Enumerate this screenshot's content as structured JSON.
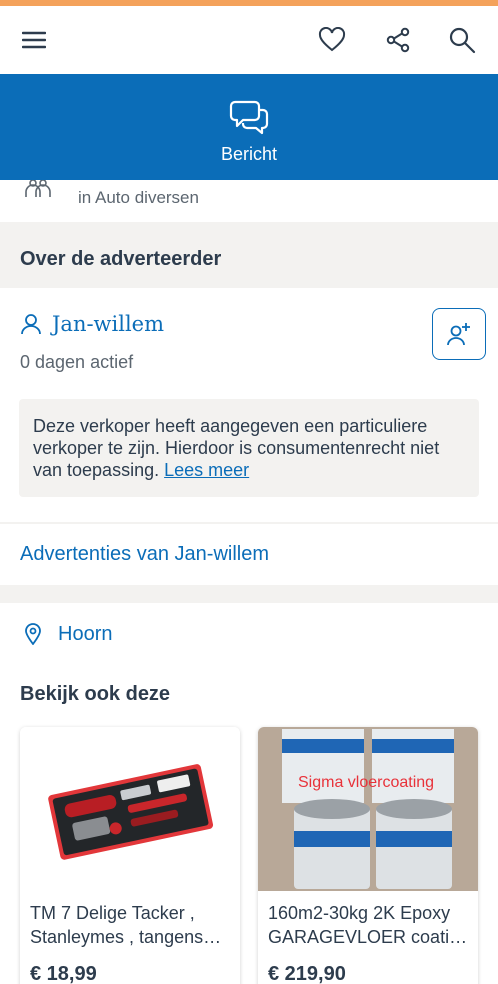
{
  "appbar": {
    "icons": [
      "menu-icon",
      "heart-icon",
      "share-icon",
      "search-icon"
    ]
  },
  "banner": {
    "label": "Bericht",
    "icon": "chat-bubbles-icon"
  },
  "category": {
    "text": "in Auto diversen"
  },
  "about": {
    "heading": "Over de adverteerder"
  },
  "advertiser": {
    "name": "Jan-willem",
    "active": "0 dagen actief",
    "notice_text": "Deze verkoper heeft aangegeven een particuliere verkoper te zijn. Hierdoor is consumentenrecht niet van toepassing.",
    "notice_link": "Lees meer"
  },
  "ads_link": "Advertenties van Jan-willem",
  "location": "Hoorn",
  "suggestions": {
    "heading": "Bekijk ook deze",
    "items": [
      {
        "title_line1": "TM 7 Delige Tacker ,",
        "title_line2": "Stanleymes ,  tangens…",
        "price": "€ 18,99"
      },
      {
        "title_line1": "160m2-30kg 2K Epoxy",
        "title_line2": "GARAGEVLOER coatin…",
        "price": "€ 219,90",
        "image_caption": "Sigma vloercoating"
      }
    ]
  },
  "colors": {
    "brand_blue": "#0b6db8",
    "top_accent": "#f4a25b",
    "background": "#f3f2f0"
  }
}
